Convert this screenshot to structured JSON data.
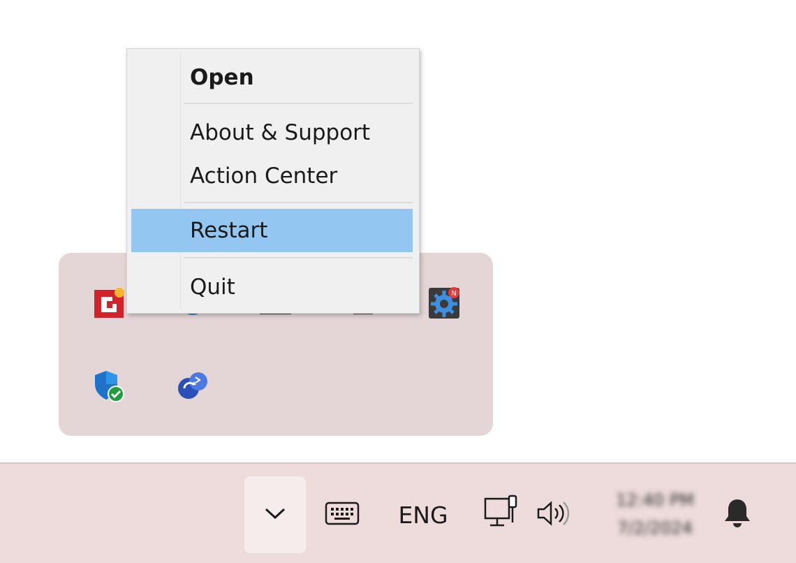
{
  "context_menu": {
    "items": [
      {
        "label": "Open",
        "bold": true
      },
      {
        "label": "About & Support"
      },
      {
        "label": "Action Center"
      },
      {
        "label": "Restart",
        "highlighted": true
      },
      {
        "label": "Quit"
      }
    ]
  },
  "tray_flyout": {
    "icons": [
      "app-logo-icon",
      "blue-circle-icon",
      "spreadsheet-icon",
      "notepad-icon",
      "settings-gear-icon",
      "windows-security-icon",
      "cloud-sync-icon"
    ]
  },
  "taskbar": {
    "language": "ENG",
    "clock_time": "12:40 PM",
    "clock_date": "7/2/2024"
  },
  "colors": {
    "menu_highlight": "#93c7f2",
    "flyout_bg": "#e4d6d6",
    "taskbar_bg": "#eedcdc"
  }
}
